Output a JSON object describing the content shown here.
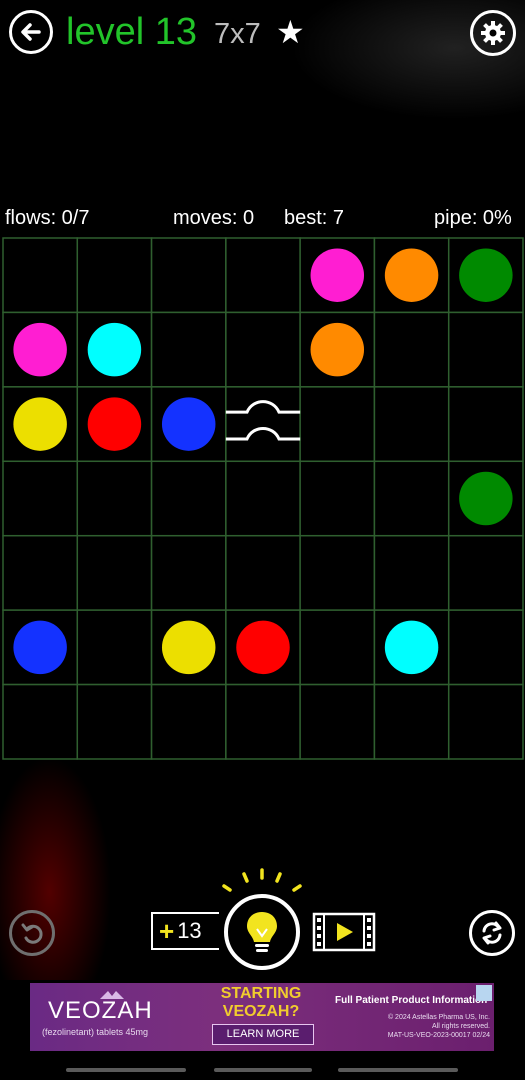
{
  "header": {
    "level_label": "level 13",
    "size_label": "7x7",
    "star": "★",
    "back_icon": "back-arrow-icon",
    "settings_icon": "gear-icon"
  },
  "stats": {
    "flows": "flows: 0/7",
    "moves": "moves: 0",
    "best": "best: 7",
    "pipe": "pipe: 0%"
  },
  "board": {
    "rows": 7,
    "cols": 7,
    "grid_color": "#2f5f2f",
    "dots": [
      {
        "row": 0,
        "col": 4,
        "color": "magenta"
      },
      {
        "row": 0,
        "col": 5,
        "color": "orange"
      },
      {
        "row": 0,
        "col": 6,
        "color": "green"
      },
      {
        "row": 1,
        "col": 0,
        "color": "magenta"
      },
      {
        "row": 1,
        "col": 1,
        "color": "cyan"
      },
      {
        "row": 1,
        "col": 4,
        "color": "orange"
      },
      {
        "row": 2,
        "col": 0,
        "color": "yellow"
      },
      {
        "row": 2,
        "col": 1,
        "color": "red"
      },
      {
        "row": 2,
        "col": 2,
        "color": "blue"
      },
      {
        "row": 3,
        "col": 6,
        "color": "green"
      },
      {
        "row": 5,
        "col": 0,
        "color": "blue"
      },
      {
        "row": 5,
        "col": 2,
        "color": "yellow"
      },
      {
        "row": 5,
        "col": 3,
        "color": "red"
      },
      {
        "row": 5,
        "col": 5,
        "color": "cyan"
      }
    ],
    "bridges": [
      {
        "row": 2,
        "col": 3
      }
    ],
    "colors": {
      "magenta": "#ff1ed2",
      "orange": "#ff8a00",
      "green": "#008a00",
      "cyan": "#00ffff",
      "yellow": "#ecdf00",
      "red": "#ff0000",
      "blue": "#1432ff"
    }
  },
  "controls": {
    "undo_icon": "undo-icon",
    "hint_plus": "+",
    "hint_count": "13",
    "hint_icon": "lightbulb-icon",
    "video_icon": "video-play-icon",
    "restart_icon": "restart-icon"
  },
  "ad": {
    "brand": "VEOZAH",
    "brand_sub": "(fezolinetant) tablets 45mg",
    "headline_line1": "STARTING",
    "headline_line2": "VEOZAH?",
    "cta": "LEARN MORE",
    "link": "Full Patient Product Information",
    "fine_1": "© 2024 Astellas Pharma US, Inc.",
    "fine_2": "All rights reserved.",
    "fine_3": "MAT-US-VEO-2023-00017 02/24"
  }
}
